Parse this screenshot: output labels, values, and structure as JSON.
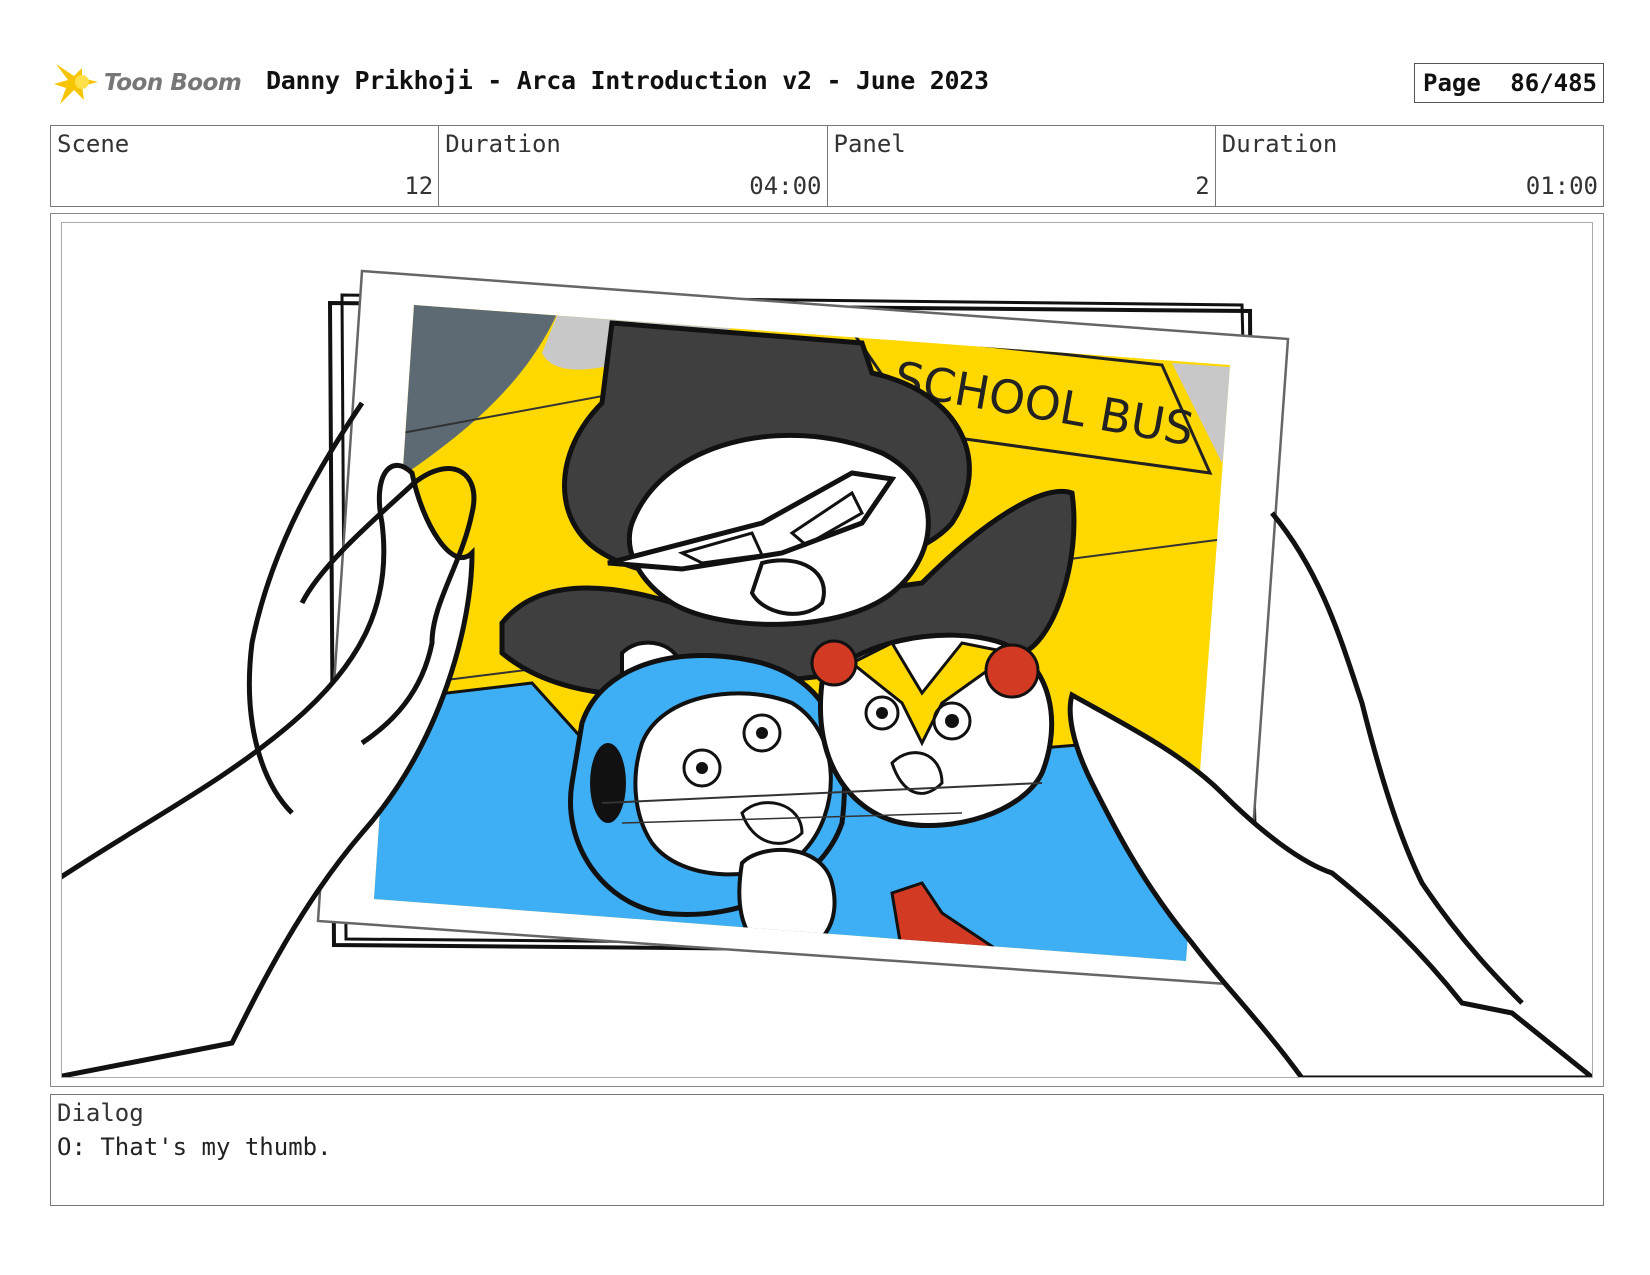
{
  "header": {
    "logo_text": "Toon Boom",
    "title": "Danny Prikhoji - Arca Introduction v2 - June 2023",
    "page_label": "Page",
    "page_number": "86/485"
  },
  "info": {
    "scene_label": "Scene",
    "scene_value": "12",
    "scene_duration_label": "Duration",
    "scene_duration_value": "04:00",
    "panel_label": "Panel",
    "panel_value": "2",
    "panel_duration_label": "Duration",
    "panel_duration_value": "01:00"
  },
  "panel_art": {
    "sign_text": "SCHOOL BUS",
    "colors": {
      "yellow": "#ffd800",
      "blue": "#3eaef5",
      "dark_gray": "#3f3f3f",
      "red": "#d23a24",
      "sky": "#5d6a74"
    }
  },
  "dialog": {
    "label": "Dialog",
    "text": "O: That's my thumb."
  }
}
